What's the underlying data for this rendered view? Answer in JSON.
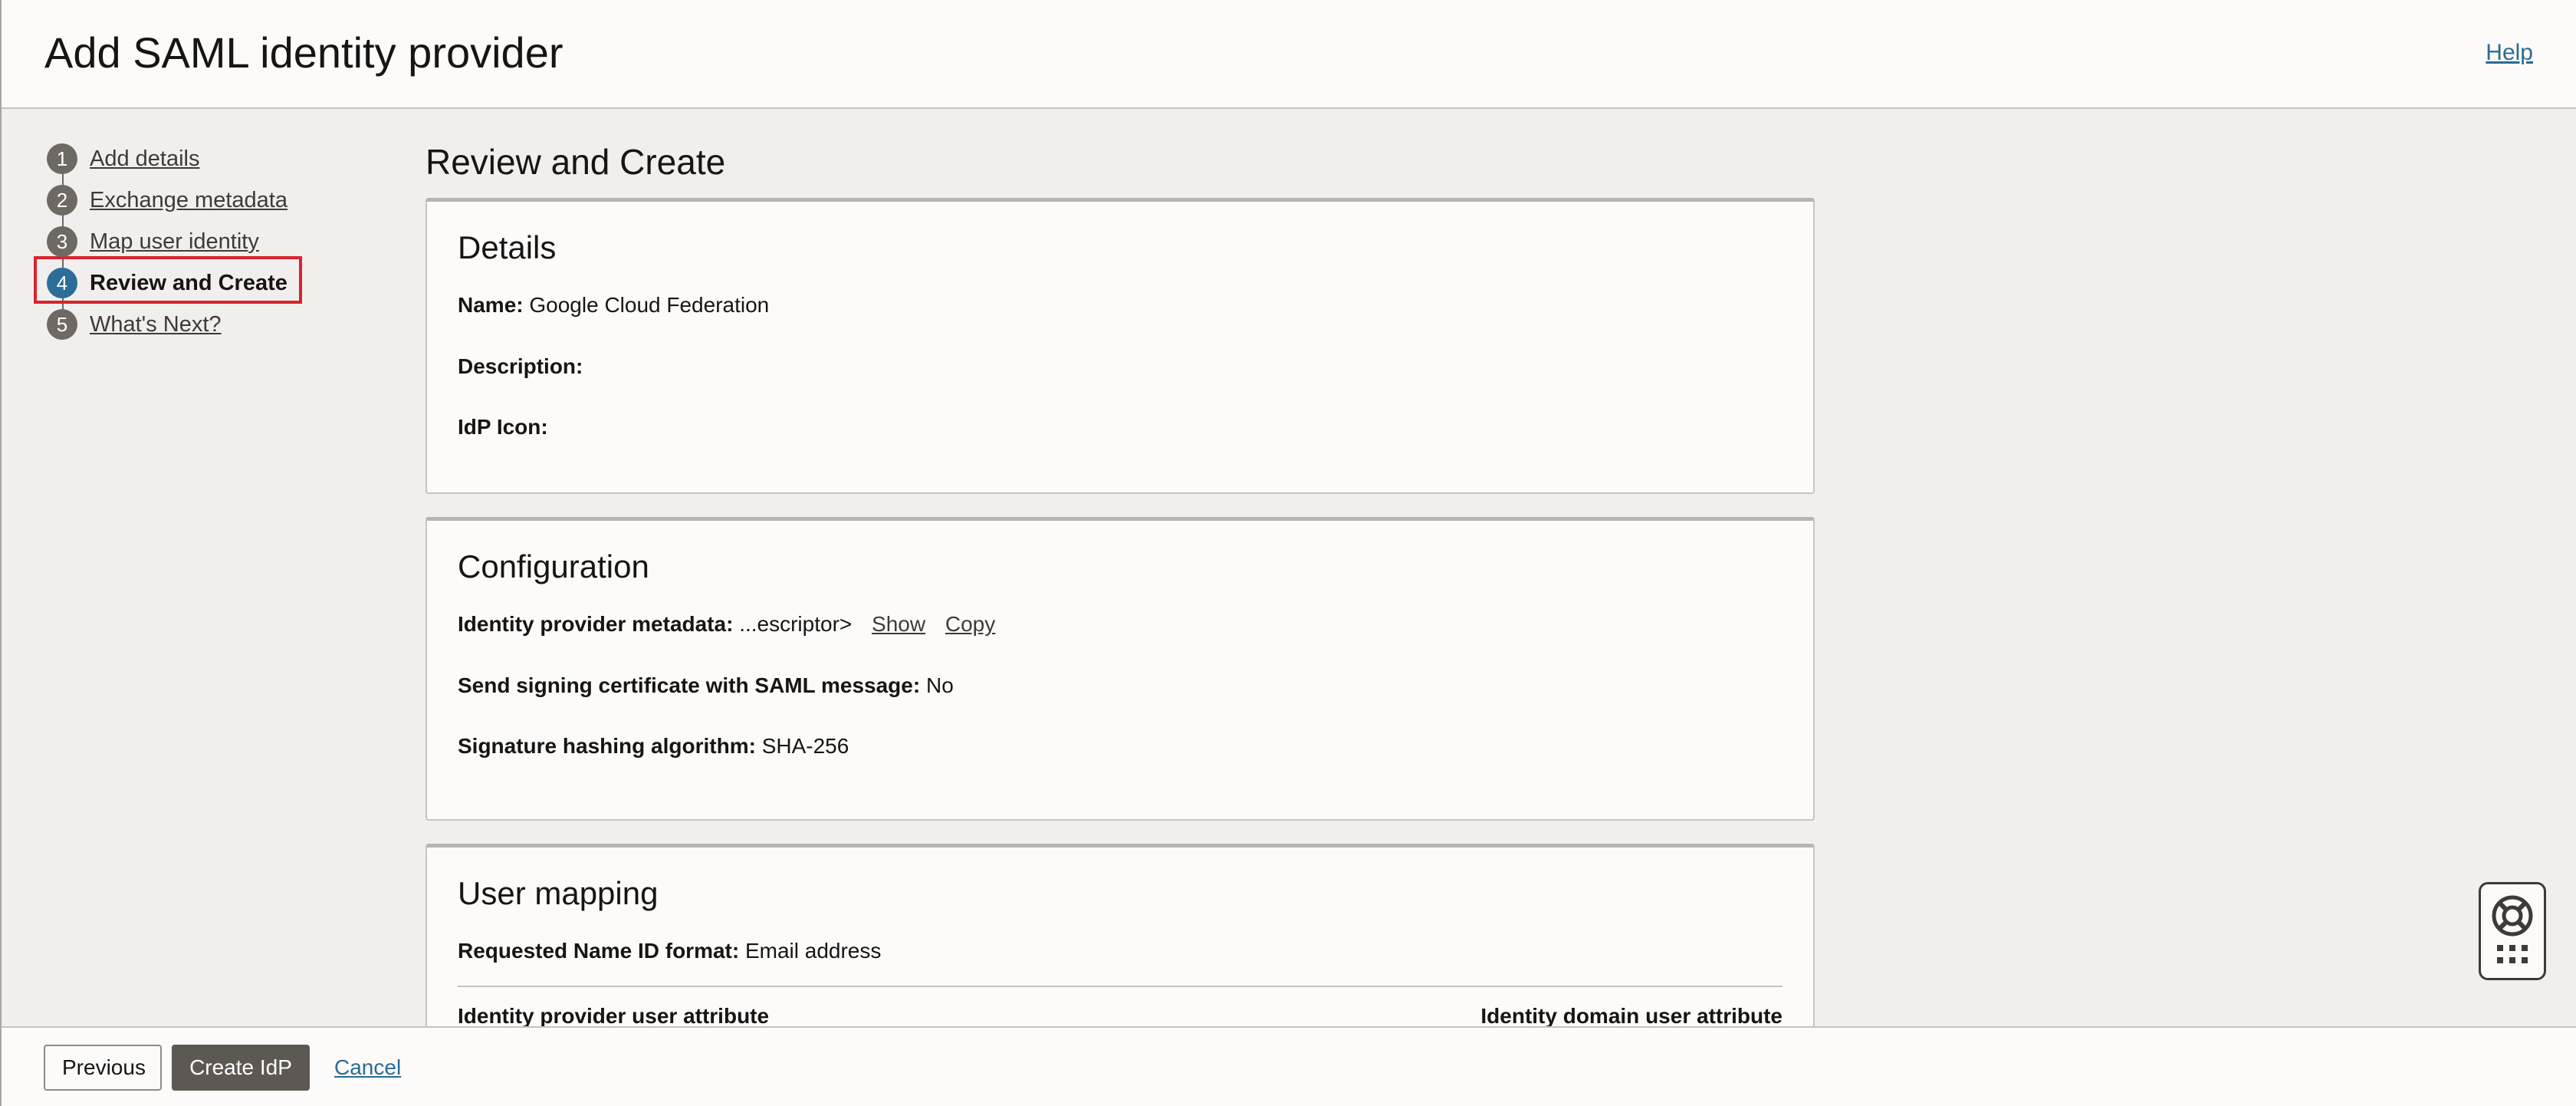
{
  "header": {
    "title": "Add SAML identity provider",
    "help_label": "Help"
  },
  "steps": [
    {
      "num": "1",
      "label": "Add details"
    },
    {
      "num": "2",
      "label": "Exchange metadata"
    },
    {
      "num": "3",
      "label": "Map user identity"
    },
    {
      "num": "4",
      "label": "Review and Create"
    },
    {
      "num": "5",
      "label": "What's Next?"
    }
  ],
  "main": {
    "title": "Review and Create",
    "details": {
      "title": "Details",
      "name_label": "Name:",
      "name_value": "Google Cloud Federation",
      "description_label": "Description:",
      "description_value": "",
      "icon_label": "IdP Icon:"
    },
    "configuration": {
      "title": "Configuration",
      "metadata_label": "Identity provider metadata:",
      "metadata_value": "...escriptor>",
      "show_label": "Show",
      "copy_label": "Copy",
      "signing_label": "Send signing certificate with SAML message:",
      "signing_value": "No",
      "hashing_label": "Signature hashing algorithm:",
      "hashing_value": "SHA-256"
    },
    "user_mapping": {
      "title": "User mapping",
      "nameid_label": "Requested Name ID format:",
      "nameid_value": "Email address",
      "col_left": "Identity provider user attribute",
      "col_right": "Identity domain user attribute"
    }
  },
  "footer": {
    "previous_label": "Previous",
    "create_label": "Create IdP",
    "cancel_label": "Cancel"
  }
}
